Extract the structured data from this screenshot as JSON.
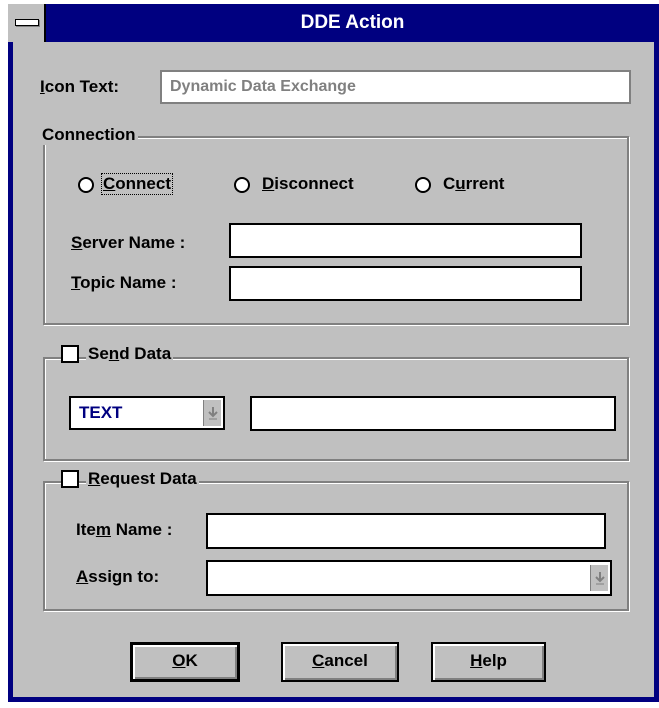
{
  "window": {
    "title": "DDE Action"
  },
  "icon_text": {
    "label_pre": "",
    "label_mnemonic": "I",
    "label_post": "con Text:",
    "value": "Dynamic Data Exchange"
  },
  "connection": {
    "title": "Connection",
    "radios": [
      {
        "mnemonic": "C",
        "rest": "onnect"
      },
      {
        "mnemonic": "D",
        "rest": "isconnect"
      },
      {
        "pre": "C",
        "mnemonic": "u",
        "rest": "rrent"
      }
    ],
    "server_label": {
      "mnemonic": "S",
      "rest": "erver Name :"
    },
    "topic_label": {
      "mnemonic": "T",
      "rest": "opic Name :"
    },
    "server_value": "",
    "topic_value": ""
  },
  "send_data": {
    "title_pre": "Se",
    "title_mnemonic": "n",
    "title_post": "d Data",
    "format_value": "TEXT",
    "data_value": ""
  },
  "request_data": {
    "title_mnemonic": "R",
    "title_post": "equest Data",
    "item_label": {
      "pre": "Ite",
      "mnemonic": "m",
      "rest": " Name :"
    },
    "assign_label": {
      "mnemonic": "A",
      "rest": "ssign to:"
    },
    "item_value": "",
    "assign_value": ""
  },
  "buttons": {
    "ok": {
      "mnemonic": "O",
      "rest": "K"
    },
    "cancel": {
      "mnemonic": "C",
      "rest": "ancel"
    },
    "help": {
      "mnemonic": "H",
      "rest": "elp"
    }
  },
  "colors": {
    "title_bar": "#000080",
    "dialog_bg": "#c0c0c0",
    "combo_text": "#000080"
  }
}
